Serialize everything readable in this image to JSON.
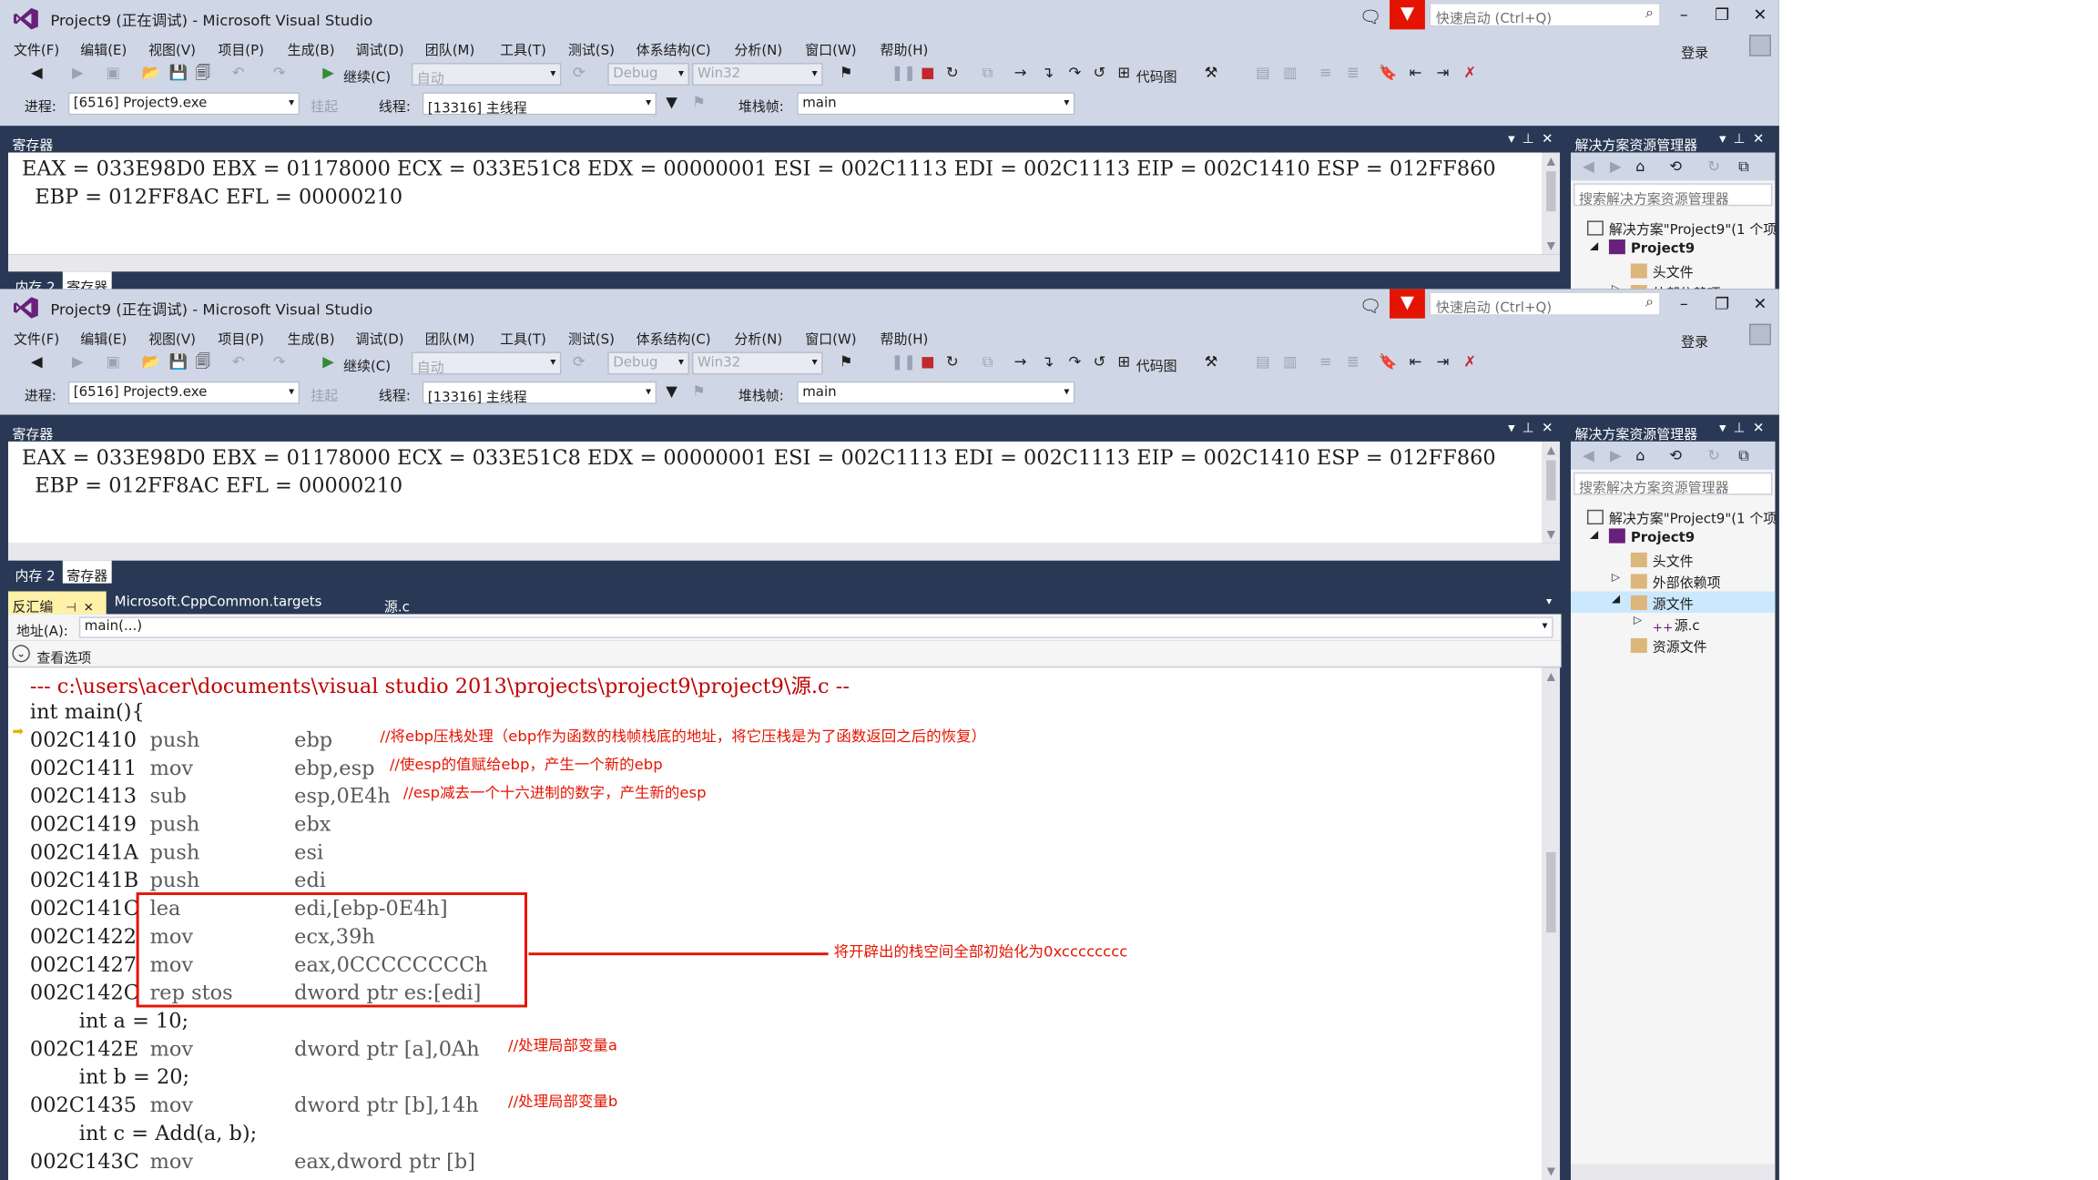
{
  "window_title": "Project9 (正在调试) - Microsoft Visual Studio",
  "quick_launch_placeholder": "快速启动 (Ctrl+Q)",
  "menu": [
    "文件(F)",
    "编辑(E)",
    "视图(V)",
    "项目(P)",
    "生成(B)",
    "调试(D)",
    "团队(M)",
    "工具(T)",
    "测试(S)",
    "体系结构(C)",
    "分析(N)",
    "窗口(W)",
    "帮助(H)"
  ],
  "login_label": "登录",
  "toolbar": {
    "continue_label": "继续(C)",
    "config_auto": "自动",
    "config_debug": "Debug",
    "platform": "Win32",
    "code_map_label": "代码图"
  },
  "debug_toolbar": {
    "process_label": "进程:",
    "process_value": "[6516] Project9.exe",
    "suspend_label": "挂起",
    "thread_label": "线程:",
    "thread_value": "[13316] 主线程",
    "stack_frame_label": "堆栈帧:",
    "stack_frame_value": "main"
  },
  "registers_panel": {
    "title": "寄存器",
    "line1": "EAX = 033E98D0 EBX = 01178000 ECX = 033E51C8 EDX = 00000001 ESI = 002C1113 EDI = 002C1113 EIP = 002C1410 ESP = 012FF860",
    "line2": "  EBP = 012FF8AC EFL = 00000210"
  },
  "bottom_tabs": [
    "内存 2",
    "寄存器"
  ],
  "solution_explorer": {
    "title": "解决方案资源管理器",
    "search_placeholder": "搜索解决方案资源管理器",
    "solution_label": "解决方案\"Project9\"(1 个项",
    "project_label": "Project9",
    "headers_label": "头文件",
    "external_deps_label": "外部依赖项",
    "sources_label": "源文件",
    "source_file_label": "源.c",
    "resources_label": "资源文件"
  },
  "doc_tabs": [
    "反汇编",
    "Microsoft.CppCommon.targets",
    "源.c"
  ],
  "address_label": "地址(A):",
  "address_value": "main(...)",
  "view_options_label": "查看选项",
  "disassembly": {
    "path_line": "--- c:\\users\\acer\\documents\\visual studio 2013\\projects\\project9\\project9\\源.c --",
    "source_main": "int main(){",
    "instructions": [
      {
        "addr": "002C1410",
        "op": "push",
        "args": "ebp"
      },
      {
        "addr": "002C1411",
        "op": "mov",
        "args": "ebp,esp"
      },
      {
        "addr": "002C1413",
        "op": "sub",
        "args": "esp,0E4h"
      },
      {
        "addr": "002C1419",
        "op": "push",
        "args": "ebx"
      },
      {
        "addr": "002C141A",
        "op": "push",
        "args": "esi"
      },
      {
        "addr": "002C141B",
        "op": "push",
        "args": "edi"
      },
      {
        "addr": "002C141C",
        "op": "lea",
        "args": "edi,[ebp-0E4h]"
      },
      {
        "addr": "002C1422",
        "op": "mov",
        "args": "ecx,39h"
      },
      {
        "addr": "002C1427",
        "op": "mov",
        "args": "eax,0CCCCCCCCh"
      },
      {
        "addr": "002C142C",
        "op": "rep stos",
        "args": "dword ptr es:[edi]"
      }
    ],
    "source_a": "int a = 10;",
    "instr_a": {
      "addr": "002C142E",
      "op": "mov",
      "args": "dword ptr [a],0Ah"
    },
    "source_b": "int b = 20;",
    "instr_b": {
      "addr": "002C1435",
      "op": "mov",
      "args": "dword ptr [b],14h"
    },
    "source_c": "int c = Add(a, b);",
    "instr_c": {
      "addr": "002C143C",
      "op": "mov",
      "args": "eax,dword ptr [b]"
    }
  },
  "annotations": {
    "push_ebp": "//将ebp压栈处理（ebp作为函数的栈帧栈底的地址，将它压栈是为了函数返回之后的恢复）",
    "mov_ebp": "//使esp的值赋给ebp，产生一个新的ebp",
    "sub_esp": "//esp减去一个十六进制的数字，产生新的esp",
    "init_block": "将开辟出的栈空间全部初始化为0xcccccccc",
    "local_a": "//处理局部变量a",
    "local_b": "//处理局部变量b"
  },
  "colors": {
    "frame": "#293955",
    "chrome": "#cfd6e5",
    "annotation_red": "#e51400",
    "vs_purple": "#68217a"
  }
}
